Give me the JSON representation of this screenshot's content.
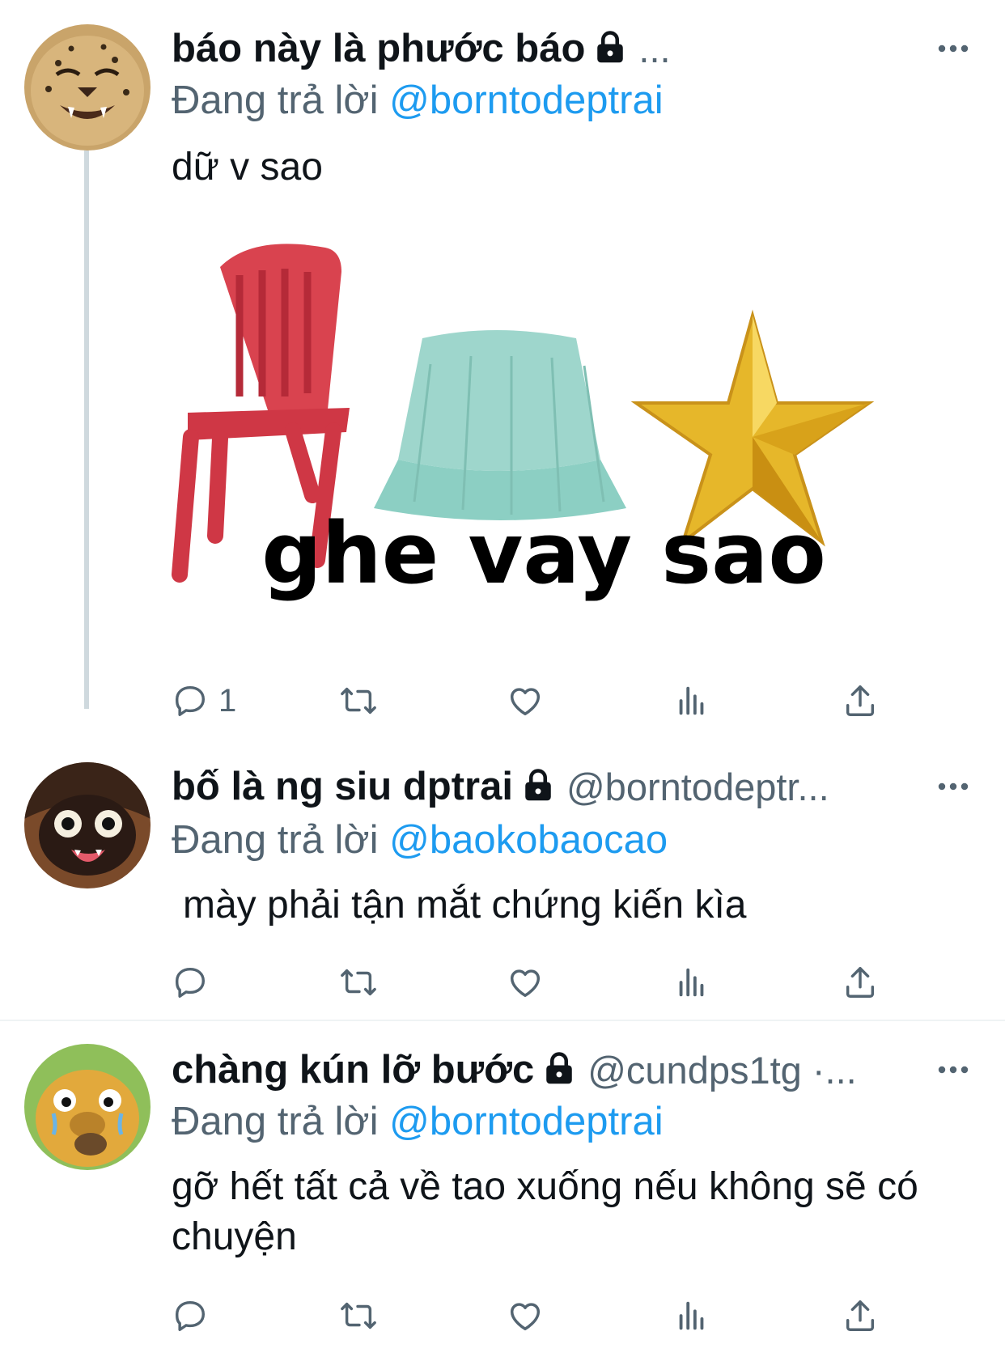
{
  "tweets": [
    {
      "display_name": "báo này là phước báo",
      "handle": "...",
      "reply_label": "Đang trả lời",
      "reply_to": "@borntodeptrai",
      "text": "dữ v sao",
      "media_caption": "ghe vay sao",
      "reply_count": "1",
      "avatar_icon": "cheetah-avatar-icon"
    },
    {
      "display_name": "bố là ng siu dptrai",
      "handle": "@borntodeptr...",
      "reply_label": "Đang trả lời",
      "reply_to": "@baokobaocao",
      "text": "mày phải tận mắt chứng kiến kìa",
      "reply_count": "",
      "avatar_icon": "cartoon-avatar-icon"
    },
    {
      "display_name": "chàng kún lỡ bước",
      "handle": "@cundps1tg ·...",
      "reply_label": "Đang trả lời",
      "reply_to": "@borntodeptrai",
      "text": "gỡ hết tất cả về tao xuống nếu không sẽ có chuyện",
      "reply_count": "",
      "avatar_icon": "jake-avatar-icon"
    }
  ],
  "colors": {
    "text_primary": "#0f1419",
    "text_secondary": "#536471",
    "link": "#1d9bf0",
    "thread_line": "#cfd9de",
    "divider": "#eff3f4"
  },
  "icons": [
    "lock-icon",
    "more-icon",
    "reply-icon",
    "retweet-icon",
    "like-icon",
    "views-icon",
    "share-icon"
  ]
}
